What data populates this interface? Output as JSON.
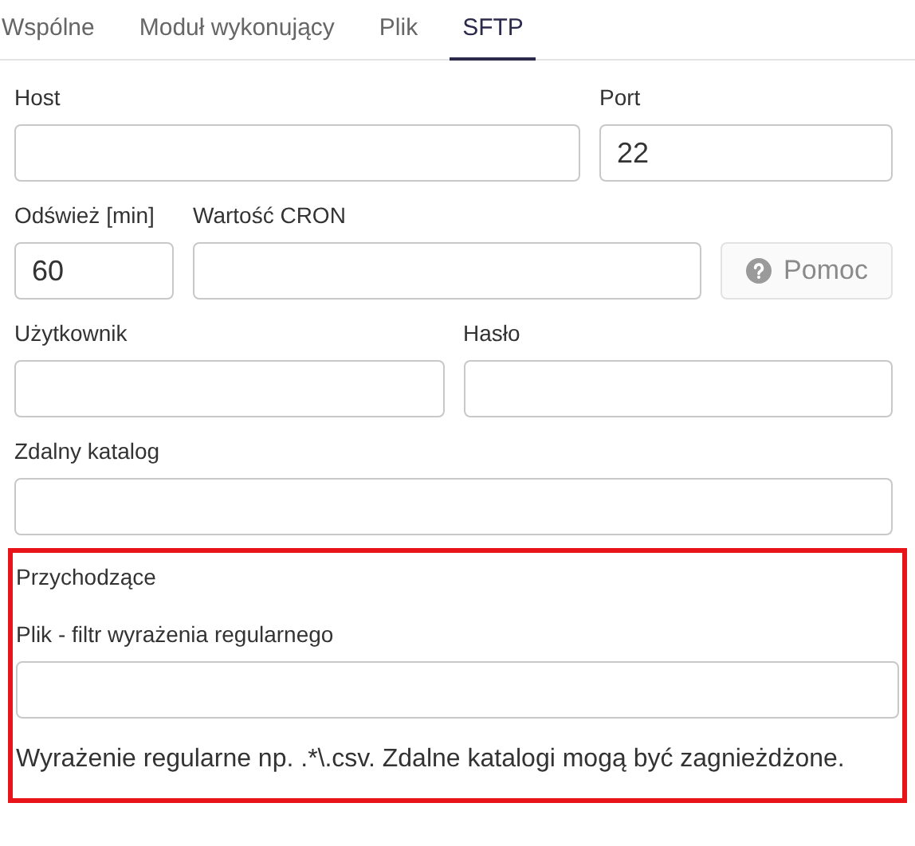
{
  "tabs": [
    {
      "label": "Wspólne",
      "selected": false
    },
    {
      "label": "Moduł wykonujący",
      "selected": false
    },
    {
      "label": "Plik",
      "selected": false
    },
    {
      "label": "SFTP",
      "selected": true
    }
  ],
  "rows": [
    [
      {
        "kind": "field",
        "label": "Host"
      },
      {
        "kind": "field",
        "label": "Port",
        "value": "22"
      }
    ],
    [
      {
        "kind": "field",
        "label": "Odśwież [min]",
        "value": "60"
      },
      {
        "kind": "field",
        "label": "Wartość CRON"
      },
      {
        "kind": "button",
        "label": "Pomoc",
        "disabled": true
      }
    ],
    [
      {
        "kind": "field",
        "label": "Użytkownik"
      },
      {
        "kind": "field",
        "label": "Hasło"
      }
    ],
    [
      {
        "kind": "field",
        "label": "Zdalny katalog"
      }
    ]
  ],
  "incoming": {
    "title": "Przychodzące",
    "field": {
      "label": "Plik - filtr wyrażenia regularnego"
    },
    "help": "Wyrażenie regularne np. .*\\.csv. Zdalne katalogi mogą być zagnieżdżone."
  }
}
